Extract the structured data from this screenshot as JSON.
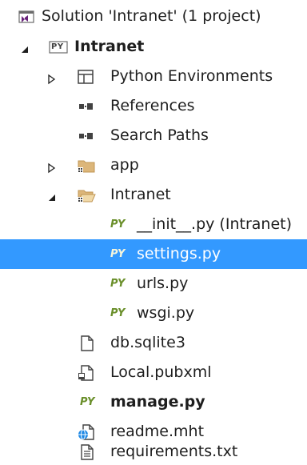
{
  "solution": {
    "label": "Solution 'Intranet' (1 project)",
    "icon": "solution-icon"
  },
  "project": {
    "label": "Intranet",
    "badge": "PY",
    "icon": "python-project-icon",
    "expanded": true
  },
  "items": {
    "python_environments": {
      "label": "Python Environments",
      "icon": "python-environments-icon",
      "expanded": false
    },
    "references": {
      "label": "References",
      "icon": "references-icon"
    },
    "search_paths": {
      "label": "Search Paths",
      "icon": "search-paths-icon"
    },
    "app_folder": {
      "label": "app",
      "icon": "folder-icon",
      "expanded": false
    },
    "intranet_folder": {
      "label": "Intranet",
      "icon": "folder-open-icon",
      "expanded": true
    },
    "init_py": {
      "label": "__init__.py (Intranet)",
      "glyph": "PY"
    },
    "settings_py": {
      "label": "settings.py",
      "glyph": "PY",
      "selected": true
    },
    "urls_py": {
      "label": "urls.py",
      "glyph": "PY"
    },
    "wsgi_py": {
      "label": "wsgi.py",
      "glyph": "PY"
    },
    "db_sqlite3": {
      "label": "db.sqlite3",
      "icon": "file-icon"
    },
    "local_pubxml": {
      "label": "Local.pubxml",
      "icon": "publish-profile-icon"
    },
    "manage_py": {
      "label": "manage.py",
      "glyph": "PY"
    },
    "readme_mht": {
      "label": "readme.mht",
      "icon": "web-file-icon"
    },
    "requirements_txt": {
      "label": "requirements.txt",
      "icon": "text-file-icon"
    }
  },
  "colors": {
    "selection": "#3399ff",
    "python_glyph": "#6a8f2a",
    "text": "#1e1e1e"
  }
}
